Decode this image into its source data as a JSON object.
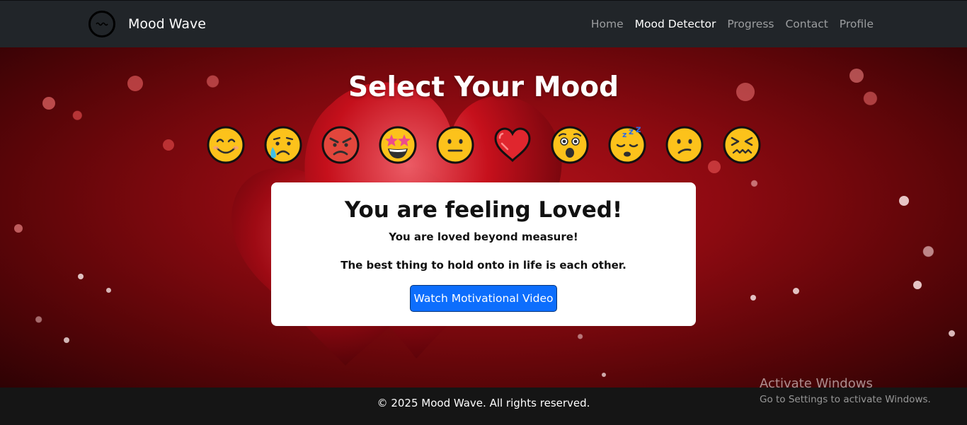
{
  "navbar": {
    "brand": "Mood Wave",
    "links": [
      {
        "label": "Home",
        "active": false
      },
      {
        "label": "Mood Detector",
        "active": true
      },
      {
        "label": "Progress",
        "active": false
      },
      {
        "label": "Contact",
        "active": false
      },
      {
        "label": "Profile",
        "active": false
      }
    ]
  },
  "hero": {
    "title": "Select Your Mood",
    "moods": [
      {
        "icon": "smiling-face-icon"
      },
      {
        "icon": "crying-face-icon"
      },
      {
        "icon": "angry-face-icon"
      },
      {
        "icon": "star-struck-face-icon"
      },
      {
        "icon": "neutral-face-icon"
      },
      {
        "icon": "red-heart-icon"
      },
      {
        "icon": "astonished-face-icon"
      },
      {
        "icon": "sleeping-face-icon"
      },
      {
        "icon": "confused-face-icon"
      },
      {
        "icon": "confounded-face-icon"
      }
    ]
  },
  "result_card": {
    "title": "You are feeling Loved!",
    "message": "You are loved beyond measure!",
    "quote": "The best thing to hold onto in life is each other.",
    "button_label": "Watch Motivational Video"
  },
  "footer": {
    "text": "© 2025 Mood Wave. All rights reserved."
  },
  "watermark": {
    "title": "Activate Windows",
    "subtitle": "Go to Settings to activate Windows."
  },
  "colors": {
    "navbar_bg": "#212529",
    "primary_button": "#0d6efd",
    "background_red": "#b4111a"
  }
}
